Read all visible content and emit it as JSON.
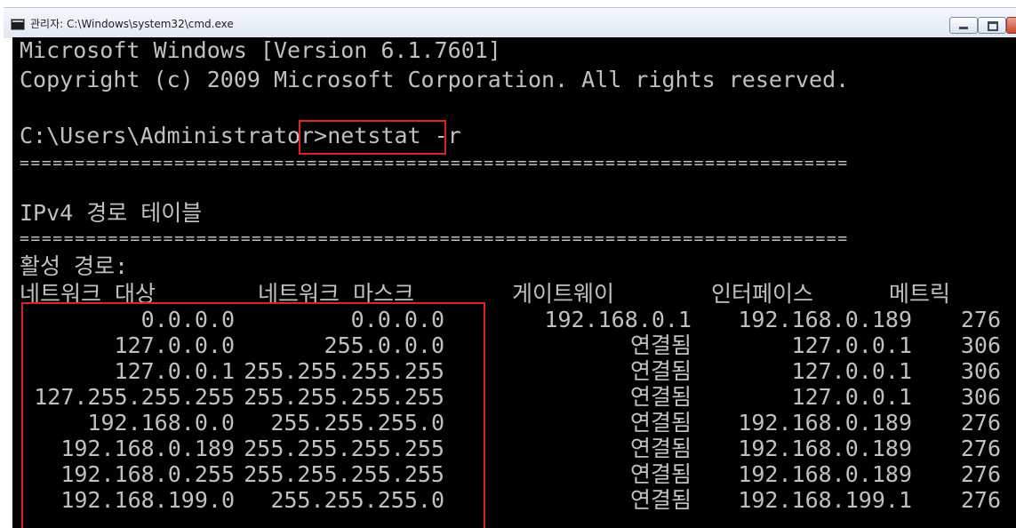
{
  "window": {
    "title": "관리자: C:\\Windows\\system32\\cmd.exe"
  },
  "console": {
    "lines": [
      "Microsoft Windows [Version 6.1.7601]",
      "Copyright (c) 2009 Microsoft Corporation. All rights reserved.",
      "",
      "C:\\Users\\Administrator>",
      "===========================================================================",
      "",
      "IPv4 경로 테이블",
      "===========================================================================",
      "활성 경로:"
    ],
    "command": "netstat -r",
    "table": {
      "headers": [
        "네트워크 대상",
        "네트워크 마스크",
        "게이트웨이",
        "인터페이스",
        "메트릭"
      ],
      "rows": [
        [
          "0.0.0.0",
          "0.0.0.0",
          "192.168.0.1",
          "192.168.0.189",
          "276"
        ],
        [
          "127.0.0.0",
          "255.0.0.0",
          "연결됨",
          "127.0.0.1",
          "306"
        ],
        [
          "127.0.0.1",
          "255.255.255.255",
          "연결됨",
          "127.0.0.1",
          "306"
        ],
        [
          "127.255.255.255",
          "255.255.255.255",
          "연결됨",
          "127.0.0.1",
          "306"
        ],
        [
          "192.168.0.0",
          "255.255.255.0",
          "연결됨",
          "192.168.0.189",
          "276"
        ],
        [
          "192.168.0.189",
          "255.255.255.255",
          "연결됨",
          "192.168.0.189",
          "276"
        ],
        [
          "192.168.0.255",
          "255.255.255.255",
          "연결됨",
          "192.168.0.189",
          "276"
        ],
        [
          "192.168.199.0",
          "255.255.255.0",
          "연결됨",
          "192.168.199.1",
          "276"
        ]
      ]
    }
  },
  "colors": {
    "console_bg": "#000000",
    "console_fg": "#c0c0c0",
    "highlight": "#e0231b"
  }
}
